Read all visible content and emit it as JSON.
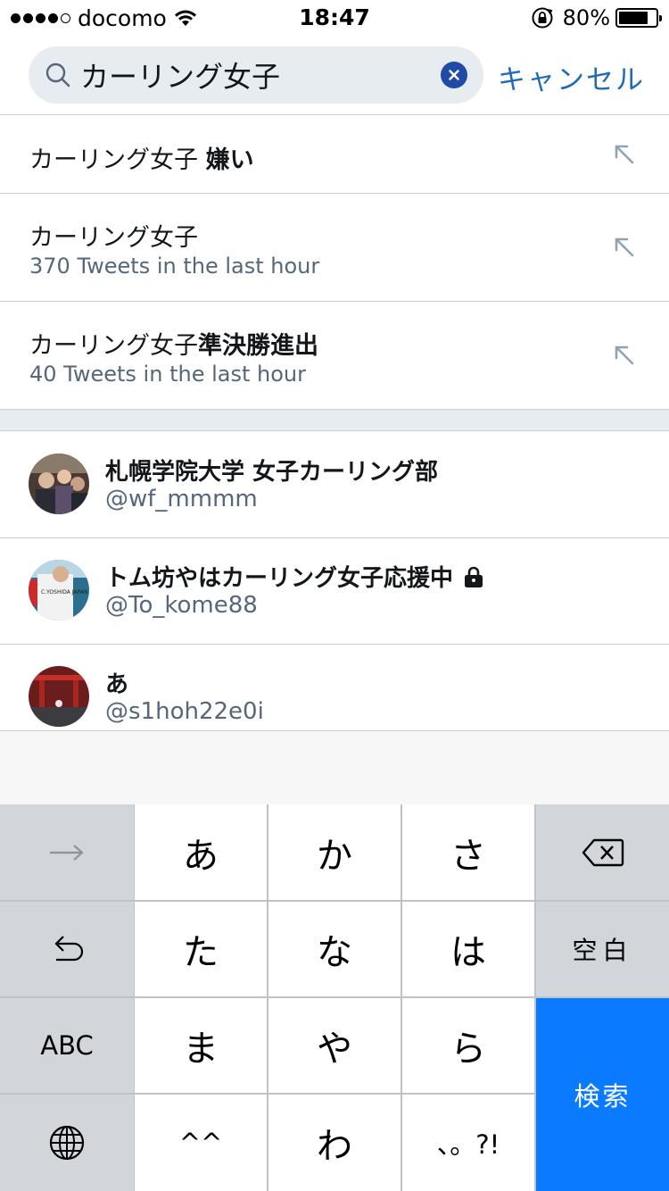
{
  "status_bar": {
    "signal_dots": 5,
    "signal_filled": 4,
    "carrier": "docomo",
    "time": "18:47",
    "battery_percent_text": "80%",
    "battery_level": 0.8
  },
  "search": {
    "query": "カーリング女子",
    "cancel_label": "キャンセル",
    "accent_color": "#1f4ba6"
  },
  "suggestions": [
    {
      "title_prefix": "カーリング女子 ",
      "title_bold": "嫌い",
      "subtitle": ""
    },
    {
      "title_prefix": "カーリング女子",
      "title_bold": "",
      "subtitle": "370 Tweets in the last hour"
    },
    {
      "title_prefix": "カーリング女子",
      "title_bold": "準決勝進出",
      "subtitle": "40 Tweets in the last hour"
    }
  ],
  "users": [
    {
      "name": "札幌学院大学 女子カーリング部",
      "handle": "@wf_mmmm",
      "protected": false
    },
    {
      "name": "トム坊やはカーリング女子応援中",
      "handle": "@To_kome88",
      "protected": true
    },
    {
      "name": "あ",
      "handle": "@s1hoh22e0i",
      "protected": false
    }
  ],
  "avatar_text": "C.YOSHIDA JAPAN",
  "keyboard": {
    "row1": [
      "あ",
      "か",
      "さ"
    ],
    "row2": [
      "た",
      "な",
      "は"
    ],
    "row3": [
      "ま",
      "や",
      "ら"
    ],
    "row4": [
      "^^",
      "わ",
      "、。?!"
    ],
    "space_label": "空白",
    "abc_label": "ABC",
    "search_label": "検索"
  }
}
